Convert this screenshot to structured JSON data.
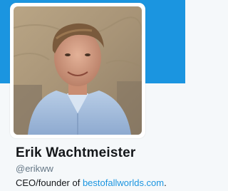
{
  "colors": {
    "banner": "#1b95e0",
    "background": "#f5f8fa",
    "link": "#1b95e0",
    "name_text": "#14171a",
    "handle_text": "#657786"
  },
  "profile": {
    "name": "Erik Wachtmeister",
    "handle": "@erikww",
    "bio_prefix": "CEO/founder of ",
    "bio_link": "bestofallworlds.com",
    "bio_suffix": "."
  },
  "avatar": {
    "icon": "profile-photo"
  }
}
